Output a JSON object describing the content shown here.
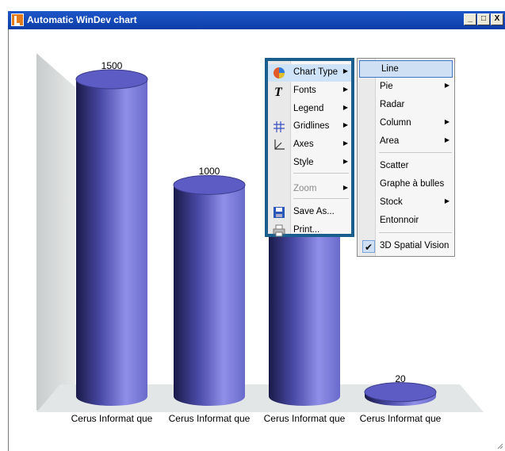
{
  "window": {
    "title": "Automatic WinDev chart",
    "buttons": {
      "minimize": "_",
      "maximize": "□",
      "close": "X"
    }
  },
  "chart_data": {
    "type": "bar",
    "style": "3d-cylinder",
    "categories": [
      "Cerus Informat que",
      "Cerus Informat que",
      "Cerus Informat que",
      "Cerus Informat que"
    ],
    "values": [
      1500,
      1000,
      1000,
      20
    ],
    "data_labels": [
      "1500",
      "1000",
      "",
      "20"
    ],
    "ylim": [
      0,
      1500
    ],
    "grid": false,
    "color": "#7070e0"
  },
  "context_menu": {
    "items": [
      {
        "label": "Chart Type",
        "mnemonic": "T",
        "icon": "chart-type-icon",
        "submenu": true,
        "selected": true
      },
      {
        "label": "Fonts",
        "icon": "font-icon",
        "submenu": true
      },
      {
        "label": "Legend",
        "submenu": true
      },
      {
        "label": "Gridlines",
        "icon": "gridlines-icon",
        "submenu": true
      },
      {
        "label": "Axes",
        "icon": "axes-icon",
        "submenu": true
      },
      {
        "label": "Style",
        "submenu": true
      },
      {
        "label": "Zoom",
        "submenu": true,
        "disabled": true
      },
      {
        "label": "Save As...",
        "icon": "save-icon"
      },
      {
        "label": "Print...",
        "icon": "print-icon"
      }
    ]
  },
  "chart_type_submenu": {
    "items": [
      {
        "label": "Line",
        "selected": true
      },
      {
        "label": "Pie",
        "submenu": true
      },
      {
        "label": "Radar"
      },
      {
        "label": "Column",
        "submenu": true
      },
      {
        "label": "Area",
        "submenu": true
      },
      {
        "label": "Scatter"
      },
      {
        "label": "Graphe à bulles"
      },
      {
        "label": "Stock",
        "submenu": true
      },
      {
        "label": "Entonnoir"
      },
      {
        "label": "3D Spatial Vision",
        "checked": true
      }
    ]
  }
}
